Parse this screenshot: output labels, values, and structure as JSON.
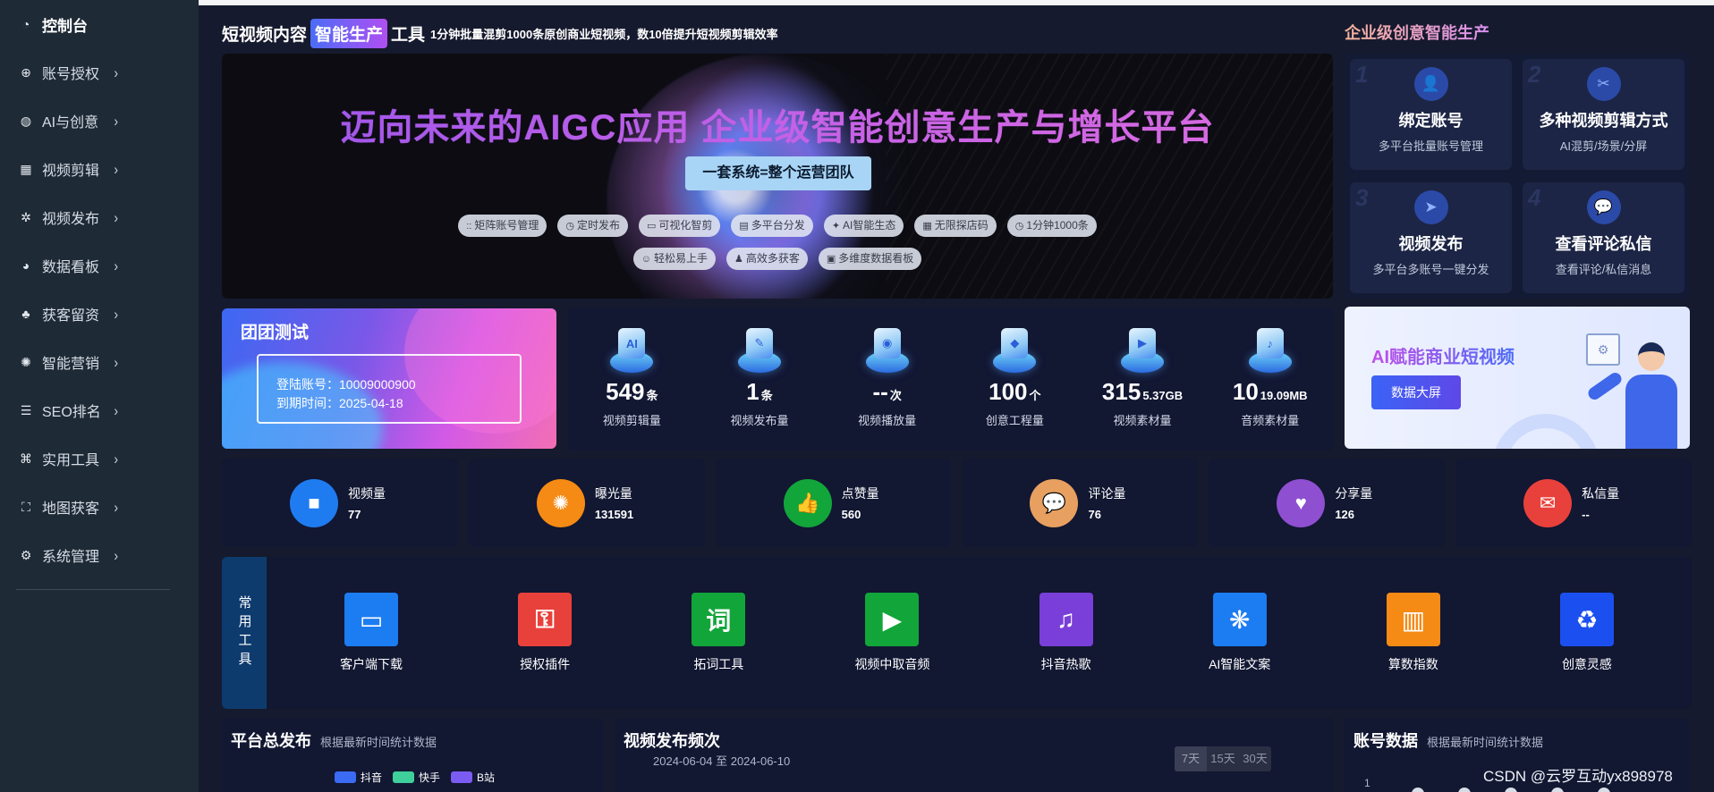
{
  "sidebar": {
    "items": [
      {
        "label": "控制台",
        "icon": "dashboard-icon",
        "glyph": "◔",
        "active": true
      },
      {
        "label": "账号授权",
        "icon": "target-icon",
        "glyph": "⊕"
      },
      {
        "label": "AI与创意",
        "icon": "globe-icon",
        "glyph": "◍"
      },
      {
        "label": "视频剪辑",
        "icon": "film-icon",
        "glyph": "▦"
      },
      {
        "label": "视频发布",
        "icon": "cog-icon",
        "glyph": "✲"
      },
      {
        "label": "数据看板",
        "icon": "pie-chart-icon",
        "glyph": "◕"
      },
      {
        "label": "获客留资",
        "icon": "org-chart-icon",
        "glyph": "♣"
      },
      {
        "label": "智能营销",
        "icon": "aperture-icon",
        "glyph": "✺"
      },
      {
        "label": "SEO排名",
        "icon": "list-icon",
        "glyph": "☰"
      },
      {
        "label": "实用工具",
        "icon": "command-icon",
        "glyph": "⌘"
      },
      {
        "label": "地图获客",
        "icon": "map-pin-icon",
        "glyph": "⛶"
      },
      {
        "label": "系统管理",
        "icon": "gear-icon",
        "glyph": "⚙"
      }
    ],
    "chevron": "›"
  },
  "header": {
    "title_prefix": "短视频内容",
    "title_tag": "智能生产",
    "title_suffix": "工具",
    "desc": "1分钟批量混剪1000条原创商业短视频，数10倍提升短视频剪辑效率",
    "right_title": "企业级创意智能生产"
  },
  "banner": {
    "title": "迈向未来的AIGC应用  企业级智能创意生产与增长平台",
    "subtitle": "一套系统=整个运营团队",
    "chips_row1": [
      {
        "icon": "::",
        "label": "矩阵账号管理"
      },
      {
        "icon": "◷",
        "label": "定时发布"
      },
      {
        "icon": "▭",
        "label": "可视化智剪"
      },
      {
        "icon": "▤",
        "label": "多平台分发"
      },
      {
        "icon": "✦",
        "label": "AI智能生态"
      },
      {
        "icon": "▦",
        "label": "无限探店码"
      },
      {
        "icon": "◷",
        "label": "1分钟1000条"
      }
    ],
    "chips_row2": [
      {
        "icon": "☺",
        "label": "轻松易上手"
      },
      {
        "icon": "♟",
        "label": "高效多获客"
      },
      {
        "icon": "▣",
        "label": "多维度数据看板"
      }
    ]
  },
  "steps": [
    {
      "num": "1",
      "title": "绑定账号",
      "desc": "多平台批量账号管理",
      "icon": "user-link-icon",
      "glyph": "👤"
    },
    {
      "num": "2",
      "title": "多种视频剪辑方式",
      "desc": "AI混剪/场景/分屏",
      "icon": "scissors-icon",
      "glyph": "✂"
    },
    {
      "num": "3",
      "title": "视频发布",
      "desc": "多平台多账号一键分发",
      "icon": "paper-plane-icon",
      "glyph": "➤"
    },
    {
      "num": "4",
      "title": "查看评论私信",
      "desc": "查看评论/私信消息",
      "icon": "chat-bubble-icon",
      "glyph": "💬"
    }
  ],
  "team": {
    "title": "团团测试",
    "account_label": "登陆账号：",
    "account": "10009000900",
    "expiry_label": "到期时间：",
    "expiry": "2025-04-18"
  },
  "stats": [
    {
      "value": "549",
      "unit": "条",
      "label": "视频剪辑量",
      "icon": "ai-cube-icon",
      "glyph": "AI"
    },
    {
      "value": "1",
      "unit": "条",
      "label": "视频发布量",
      "icon": "document-cube-icon",
      "glyph": "✎"
    },
    {
      "value": "--",
      "unit": "次",
      "label": "视频播放量",
      "icon": "camera-cube-icon",
      "glyph": "◉"
    },
    {
      "value": "100",
      "unit": "个",
      "label": "创意工程量",
      "icon": "stack-cube-icon",
      "glyph": "◆"
    },
    {
      "value": "315",
      "unit": "5.37GB",
      "label": "视频素材量",
      "icon": "video-cube-icon",
      "glyph": "▶"
    },
    {
      "value": "10",
      "unit": "19.09MB",
      "label": "音频素材量",
      "icon": "audio-cube-icon",
      "glyph": "♪"
    }
  ],
  "promo": {
    "title": "AI赋能商业短视频",
    "button": "数据大屏"
  },
  "metrics": [
    {
      "label": "视频量",
      "value": "77",
      "icon": "video-camera-icon",
      "glyph": "■",
      "color": "#1f7cf0"
    },
    {
      "label": "曝光量",
      "value": "131591",
      "icon": "aperture-icon",
      "glyph": "✺",
      "color": "#f58a14"
    },
    {
      "label": "点赞量",
      "value": "560",
      "icon": "thumbs-up-icon",
      "glyph": "👍",
      "color": "#12a53a"
    },
    {
      "label": "评论量",
      "value": "76",
      "icon": "comment-icon",
      "glyph": "💬",
      "color": "#e8a060"
    },
    {
      "label": "分享量",
      "value": "126",
      "icon": "user-heart-icon",
      "glyph": "♥",
      "color": "#8e4fd0"
    },
    {
      "label": "私信量",
      "value": "--",
      "icon": "envelope-icon",
      "glyph": "✉",
      "color": "#e8413b"
    }
  ],
  "tools": {
    "label": "常用工具",
    "items": [
      {
        "label": "客户端下载",
        "icon": "monitor-chart-icon",
        "glyph": "▭",
        "color": "#1c7cf2"
      },
      {
        "label": "授权插件",
        "icon": "key-shield-icon",
        "glyph": "⚿",
        "color": "#e8413b"
      },
      {
        "label": "拓词工具",
        "icon": "word-icon",
        "glyph": "词",
        "color": "#12a53a"
      },
      {
        "label": "视频中取音频",
        "icon": "video-camera-icon",
        "glyph": "▶",
        "color": "#12a53a"
      },
      {
        "label": "抖音热歌",
        "icon": "music-note-icon",
        "glyph": "♫",
        "color": "#7a3fd8"
      },
      {
        "label": "AI智能文案",
        "icon": "openai-icon",
        "glyph": "❋",
        "color": "#1c7cf2"
      },
      {
        "label": "算数指数",
        "icon": "bar-chart-icon",
        "glyph": "▥",
        "color": "#f58a14"
      },
      {
        "label": "创意灵感",
        "icon": "recycle-icon",
        "glyph": "♻",
        "color": "#1c4ff0"
      }
    ]
  },
  "panels": {
    "platform": {
      "title": "平台总发布",
      "subtitle": "根据最新时间统计数据",
      "legend": [
        {
          "name": "抖音",
          "color": "#3b6bf2"
        },
        {
          "name": "快手",
          "color": "#3ecf9a"
        },
        {
          "name": "B站",
          "color": "#7b5cf2"
        }
      ]
    },
    "frequency": {
      "title": "视频发布频次",
      "date_range": "2024-06-04 至 2024-06-10",
      "ranges": [
        "7天",
        "15天",
        "30天"
      ]
    },
    "account": {
      "title": "账号数据",
      "subtitle": "根据最新时间统计数据",
      "ytick": "1"
    }
  },
  "watermark": "CSDN @云罗互动yx898978"
}
